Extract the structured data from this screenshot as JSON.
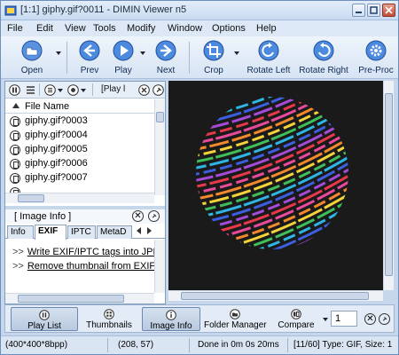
{
  "window": {
    "title": "[1:1] giphy.gif?0011 - DIMIN Viewer n5"
  },
  "menu": [
    "File",
    "Edit",
    "View",
    "Tools",
    "Modify",
    "Window",
    "Options",
    "Help"
  ],
  "toolbar": {
    "open": "Open",
    "prev": "Prev",
    "play": "Play",
    "next": "Next",
    "crop": "Crop",
    "rotate_left": "Rotate Left",
    "rotate_right": "Rotate Right",
    "preproc": "Pre-Proc"
  },
  "left_panel": {
    "mode_label": "[Play l",
    "column_header": "File Name",
    "files": [
      "giphy.gif?0003",
      "giphy.gif?0004",
      "giphy.gif?0005",
      "giphy.gif?0006",
      "giphy.gif?0007"
    ]
  },
  "image_info": {
    "title": "[ Image Info ]",
    "close_symbol": "✕",
    "tabs": [
      "Info",
      "EXIF",
      "IPTC",
      "MetaD"
    ],
    "active_tab": "EXIF",
    "links": [
      {
        "prefix": ">>",
        "text": "Write EXIF/IPTC tags into JPE"
      },
      {
        "prefix": ">>",
        "text": "Remove thumbnail from EXIF"
      }
    ]
  },
  "bottom_panel": {
    "buttons": [
      "Play List",
      "Thumbnails",
      "Image Info",
      "Folder Manager",
      "Compare"
    ],
    "active_buttons": [
      "Play List",
      "Image Info"
    ],
    "compare_count": "1",
    "close_symbol": "✕"
  },
  "status_bar": {
    "dimensions": "(400*400*8bpp)",
    "coords": "(208, 57)",
    "timing": "Done in 0m 0s 20ms",
    "info": "[11/60] Type: GIF, Size: 1"
  },
  "colors": {
    "accent": "#2f6fd0",
    "viewer_bg": "#1a1a1a",
    "sphere_stripes": [
      "#e84a9c",
      "#f28a2d",
      "#f3d23a",
      "#3fbf5a",
      "#2fb5e3",
      "#3c5fe0",
      "#a64ad8",
      "#e8394a"
    ]
  }
}
